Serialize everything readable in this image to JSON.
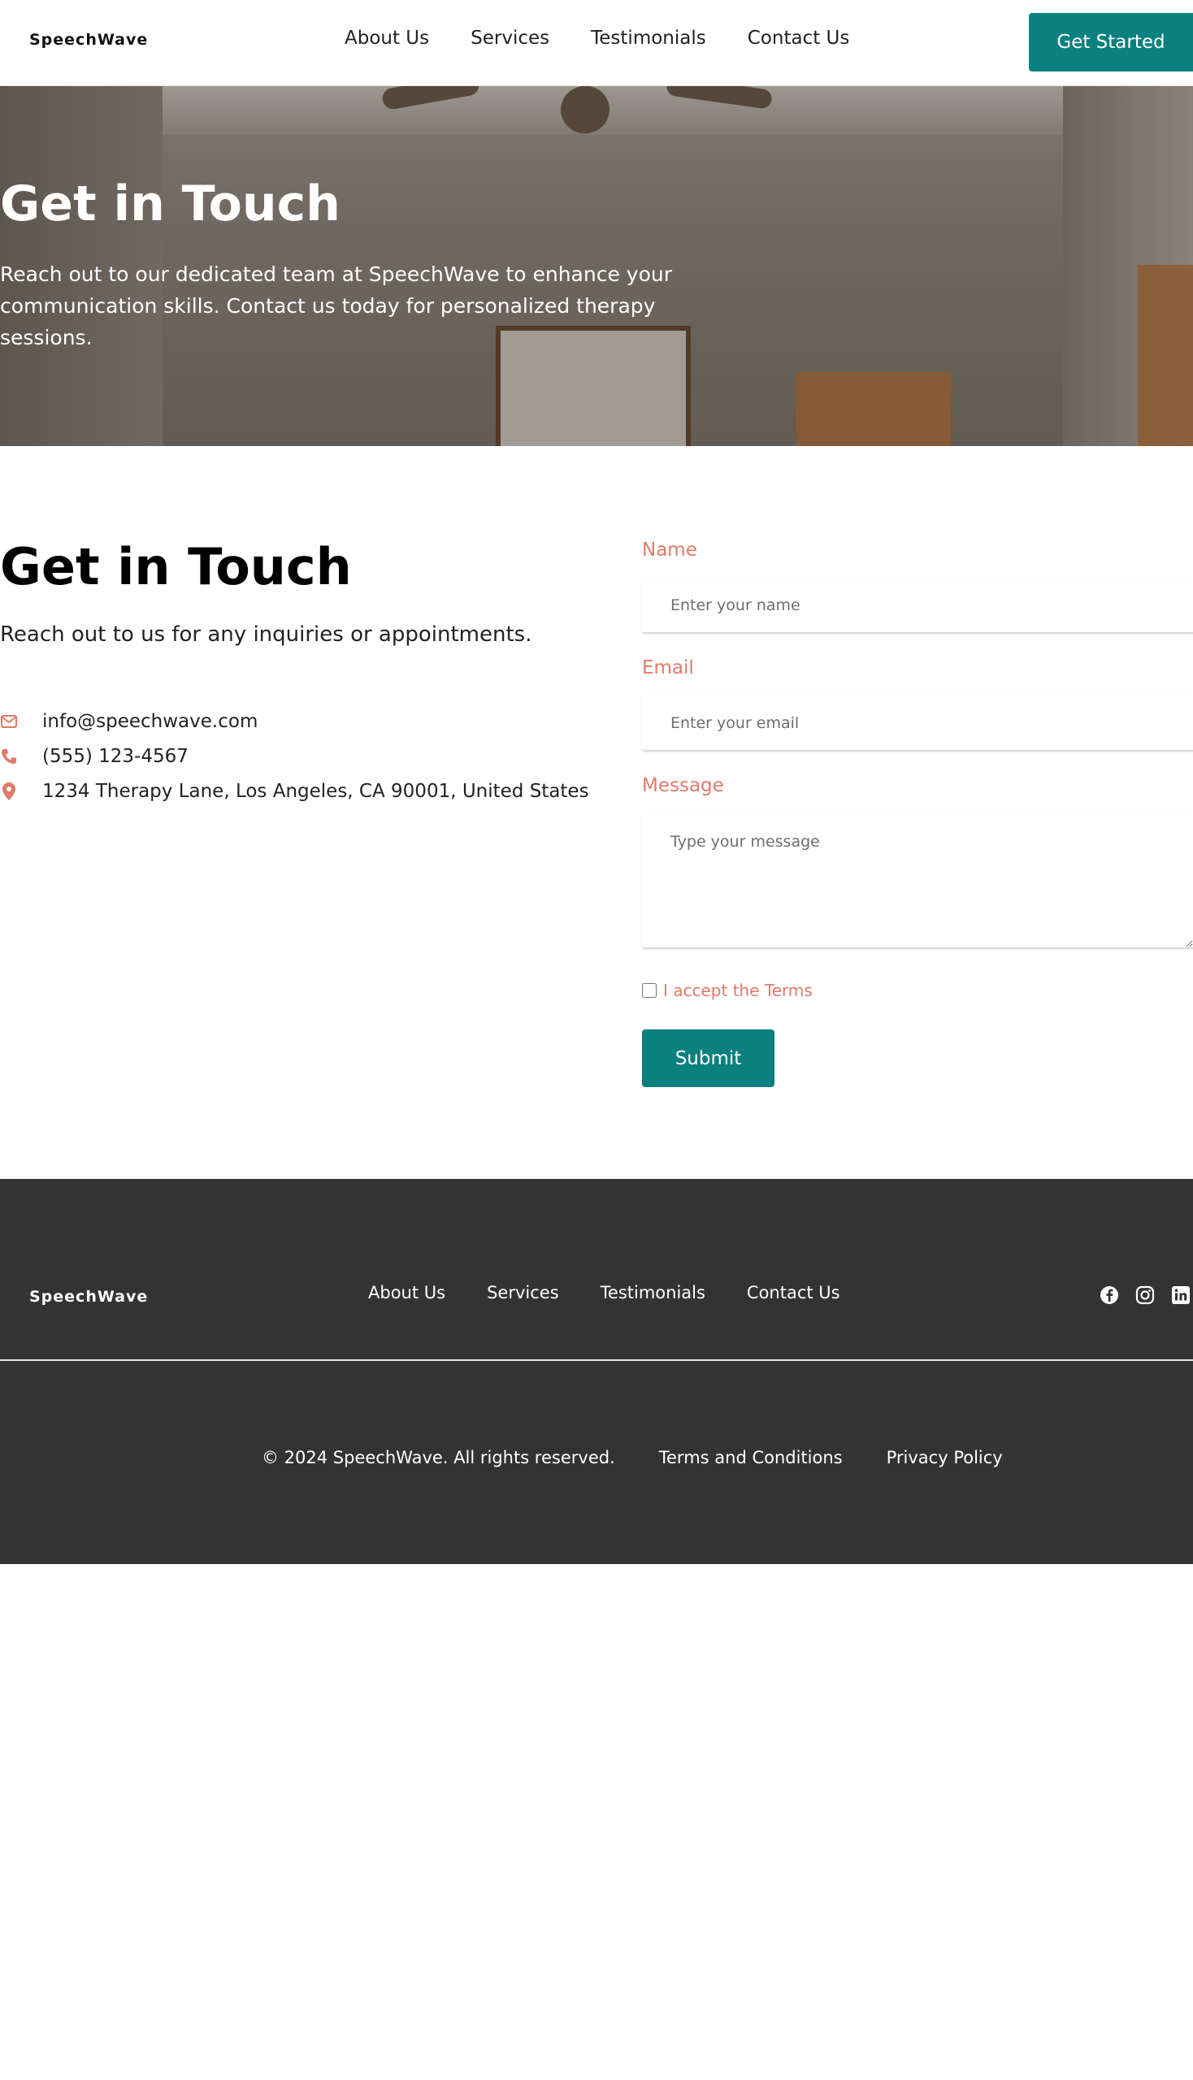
{
  "header": {
    "logo": "SpeechWave",
    "nav": [
      "About Us",
      "Services",
      "Testimonials",
      "Contact Us"
    ],
    "cta_label": "Get Started",
    "accent_color": "#0b8080"
  },
  "hero": {
    "title": "Get in Touch",
    "subtitle": "Reach out to our dedicated team at SpeechWave to enhance your communication skills. Contact us today for personalized therapy sessions."
  },
  "contact": {
    "title": "Get in Touch",
    "subtitle": "Reach out to us for any inquiries or appointments.",
    "info": [
      {
        "icon": "envelope-icon",
        "text": "info@speechwave.com"
      },
      {
        "icon": "phone-icon",
        "text": "(555) 123-4567"
      },
      {
        "icon": "map-pin-icon",
        "text": "1234 Therapy Lane, Los Angeles, CA 90001, United States"
      }
    ],
    "label_color": "#e07a6a"
  },
  "form": {
    "name_label": "Name",
    "name_placeholder": "Enter your name",
    "email_label": "Email",
    "email_placeholder": "Enter your email",
    "message_label": "Message",
    "message_placeholder": "Type your message",
    "terms_label": "I accept the Terms",
    "terms_checked": false,
    "submit_label": "Submit"
  },
  "footer": {
    "logo": "SpeechWave",
    "nav": [
      "About Us",
      "Services",
      "Testimonials",
      "Contact Us"
    ],
    "social": [
      "facebook-icon",
      "instagram-icon",
      "linkedin-icon"
    ],
    "copyright": "© 2024 SpeechWave. All rights reserved.",
    "terms_link": "Terms and Conditions",
    "privacy_link": "Privacy Policy",
    "background": "#333333"
  }
}
